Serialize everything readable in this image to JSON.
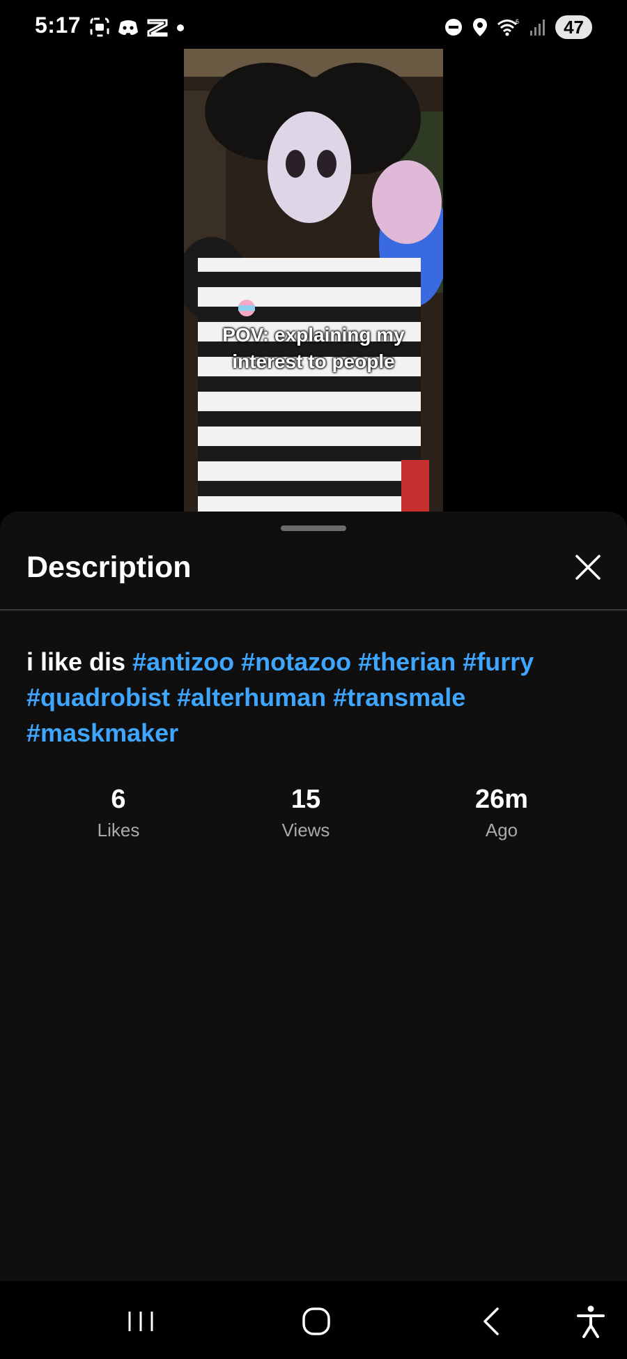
{
  "status_bar": {
    "time": "5:17",
    "battery": "47"
  },
  "video": {
    "caption_line1": "POV: explaining my",
    "caption_line2": "interest to people"
  },
  "sheet": {
    "title": "Description",
    "description_plain": "i like dis",
    "hashtags": [
      "#antizoo",
      "#notazoo",
      "#therian",
      "#furry",
      "#quadrobist",
      "#alterhuman",
      "#transmale",
      "#maskmaker"
    ],
    "stats": [
      {
        "value": "6",
        "label": "Likes"
      },
      {
        "value": "15",
        "label": "Views"
      },
      {
        "value": "26m",
        "label": "Ago"
      }
    ]
  },
  "colors": {
    "hashtag": "#3ea6ff",
    "sheet_bg": "#0f0f0f",
    "muted_text": "#aaaaaa"
  },
  "nav": {
    "icons": [
      "recent-apps-icon",
      "home-icon",
      "back-icon",
      "accessibility-icon"
    ]
  }
}
